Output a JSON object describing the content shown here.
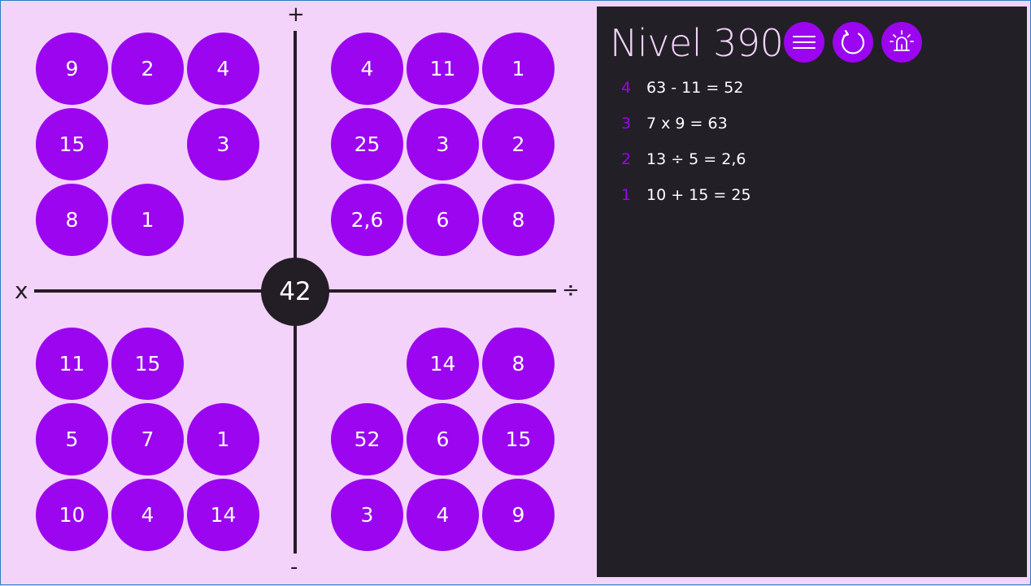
{
  "board": {
    "target": "42",
    "symbols": {
      "top": "+",
      "bottom": "-",
      "left": "x",
      "right": "÷"
    },
    "quadrants": {
      "top_left": [
        [
          "9",
          "2",
          "4"
        ],
        [
          "15",
          "",
          "3"
        ],
        [
          "8",
          "1",
          ""
        ]
      ],
      "top_right": [
        [
          "4",
          "11",
          "1"
        ],
        [
          "25",
          "3",
          "2"
        ],
        [
          "2,6",
          "6",
          "8"
        ]
      ],
      "bottom_left": [
        [
          "11",
          "15",
          ""
        ],
        [
          "5",
          "7",
          "1"
        ],
        [
          "10",
          "4",
          "14"
        ]
      ],
      "bottom_right": [
        [
          "",
          "14",
          "8"
        ],
        [
          "52",
          "6",
          "15"
        ],
        [
          "3",
          "4",
          "9"
        ]
      ]
    }
  },
  "panel": {
    "title": "Nivel 390",
    "buttons": [
      {
        "name": "menu-button",
        "icon": "menu-icon"
      },
      {
        "name": "restart-button",
        "icon": "refresh-icon"
      },
      {
        "name": "hint-button",
        "icon": "alarm-light-icon"
      }
    ],
    "history": [
      {
        "step": "4",
        "expr": "63 - 11 = 52"
      },
      {
        "step": "3",
        "expr": "7 x 9 = 63"
      },
      {
        "step": "2",
        "expr": "13 ÷ 5 = 2,6"
      },
      {
        "step": "1",
        "expr": "10 + 15 = 25"
      }
    ]
  },
  "colors": {
    "bg": "#f3d3f9",
    "accent": "#9b05ef",
    "dark": "#231f27"
  }
}
